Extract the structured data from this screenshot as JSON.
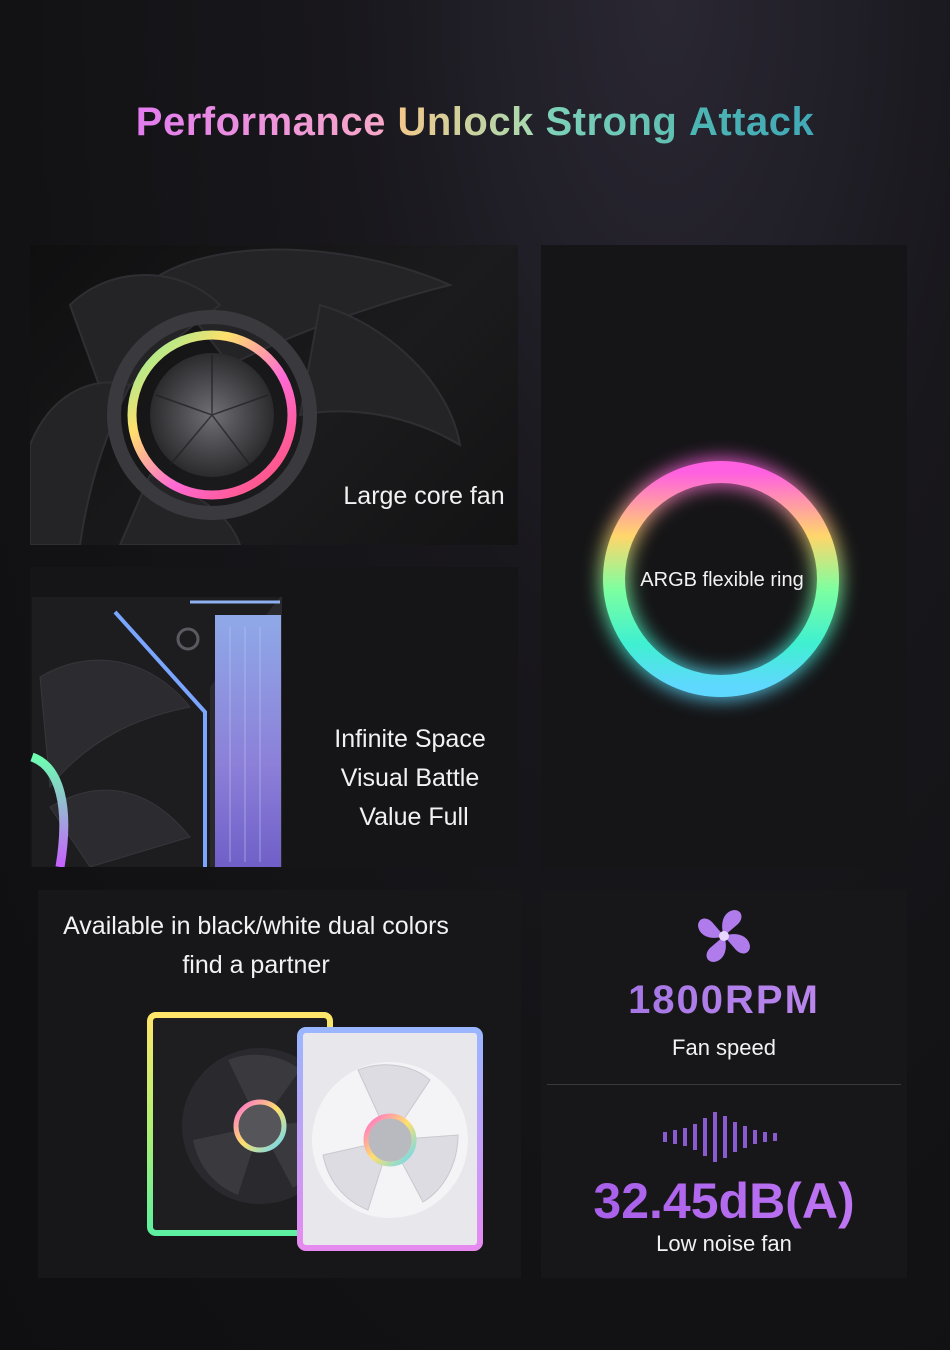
{
  "title": {
    "word1": "Performance",
    "word2": "Unlock",
    "word3": "Strong",
    "word4": "Attack"
  },
  "panels": {
    "fan": {
      "caption": "Large core fan"
    },
    "ring": {
      "caption": "ARGB flexible ring"
    },
    "frame": {
      "line1": "Infinite Space",
      "line2": "Visual Battle",
      "line3": "Value Full"
    },
    "colors": {
      "line1": "Available in black/white dual colors",
      "line2": "find a partner"
    },
    "stats": {
      "rpm_value": "1800RPM",
      "rpm_label": "Fan speed",
      "noise_value": "32.45dB(A)",
      "noise_label": "Low noise fan"
    }
  },
  "icons": {
    "fan_icon": "fan-icon",
    "sound_wave_icon": "sound-wave-icon"
  },
  "colors": {
    "rpm_accent": "#b07cec",
    "noise_accent": "#b36cf0",
    "ring_gradient": [
      "#ff5fe1",
      "#ffd66b",
      "#7dffa0",
      "#3ff0d0",
      "#5fb9ff"
    ]
  }
}
